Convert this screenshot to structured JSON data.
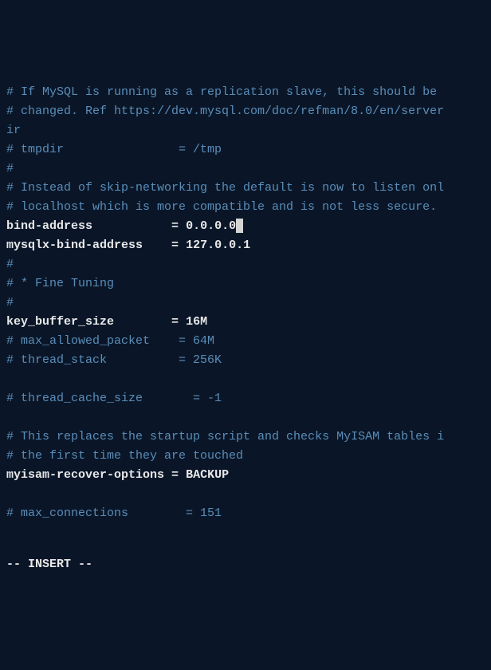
{
  "lines": [
    {
      "type": "comment",
      "text": "# If MySQL is running as a replication slave, this should be "
    },
    {
      "type": "comment",
      "text": "# changed. Ref https://dev.mysql.com/doc/refman/8.0/en/server"
    },
    {
      "type": "comment",
      "text": "ir"
    },
    {
      "type": "comment",
      "text": "# tmpdir                = /tmp"
    },
    {
      "type": "comment",
      "text": "#"
    },
    {
      "type": "comment",
      "text": "# Instead of skip-networking the default is now to listen onl"
    },
    {
      "type": "comment",
      "text": "# localhost which is more compatible and is not less secure."
    },
    {
      "type": "active-cursor",
      "key": "bind-address           ",
      "sep": "= ",
      "value": "0.0.0.0"
    },
    {
      "type": "active",
      "key": "mysqlx-bind-address    ",
      "sep": "= ",
      "value": "127.0.0.1"
    },
    {
      "type": "comment",
      "text": "#"
    },
    {
      "type": "comment",
      "text": "# * Fine Tuning"
    },
    {
      "type": "comment",
      "text": "#"
    },
    {
      "type": "active",
      "key": "key_buffer_size        ",
      "sep": "= ",
      "value": "16M"
    },
    {
      "type": "comment",
      "text": "# max_allowed_packet    = 64M"
    },
    {
      "type": "comment",
      "text": "# thread_stack          = 256K"
    },
    {
      "type": "empty",
      "text": ""
    },
    {
      "type": "comment",
      "text": "# thread_cache_size       = -1"
    },
    {
      "type": "empty",
      "text": ""
    },
    {
      "type": "comment",
      "text": "# This replaces the startup script and checks MyISAM tables i"
    },
    {
      "type": "comment",
      "text": "# the first time they are touched"
    },
    {
      "type": "active",
      "key": "myisam-recover-options ",
      "sep": "= ",
      "value": "BACKUP"
    },
    {
      "type": "empty",
      "text": ""
    },
    {
      "type": "comment",
      "text": "# max_connections        = 151"
    }
  ],
  "status": "-- INSERT --"
}
